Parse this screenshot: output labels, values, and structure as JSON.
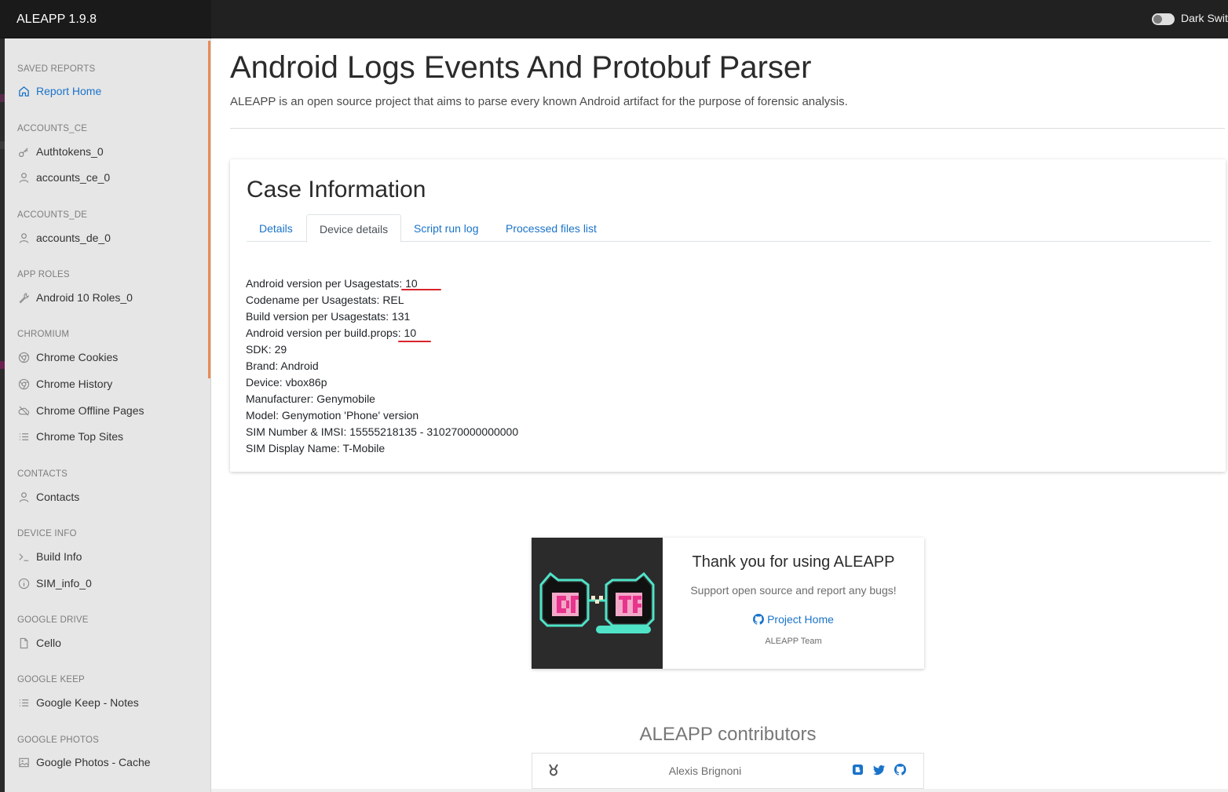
{
  "app": {
    "title": "ALEAPP 1.9.8",
    "dark_switch_label": "Dark Switch"
  },
  "sidebar": {
    "sections": [
      {
        "header": "SAVED REPORTS",
        "items": [
          {
            "label": "Report Home",
            "icon": "home-icon",
            "active": true
          }
        ]
      },
      {
        "header": "ACCOUNTS_CE",
        "items": [
          {
            "label": "Authtokens_0",
            "icon": "key-icon"
          },
          {
            "label": "accounts_ce_0",
            "icon": "user-icon"
          }
        ]
      },
      {
        "header": "ACCOUNTS_DE",
        "items": [
          {
            "label": "accounts_de_0",
            "icon": "user-icon"
          }
        ]
      },
      {
        "header": "APP ROLES",
        "items": [
          {
            "label": "Android 10 Roles_0",
            "icon": "wrench-icon"
          }
        ]
      },
      {
        "header": "CHROMIUM",
        "items": [
          {
            "label": "Chrome Cookies",
            "icon": "chrome-icon"
          },
          {
            "label": "Chrome History",
            "icon": "chrome-icon"
          },
          {
            "label": "Chrome Offline Pages",
            "icon": "cloud-off-icon"
          },
          {
            "label": "Chrome Top Sites",
            "icon": "list-icon"
          }
        ]
      },
      {
        "header": "CONTACTS",
        "items": [
          {
            "label": "Contacts",
            "icon": "user-icon"
          }
        ]
      },
      {
        "header": "DEVICE INFO",
        "items": [
          {
            "label": "Build Info",
            "icon": "terminal-icon"
          },
          {
            "label": "SIM_info_0",
            "icon": "info-icon"
          }
        ]
      },
      {
        "header": "GOOGLE DRIVE",
        "items": [
          {
            "label": "Cello",
            "icon": "file-icon"
          }
        ]
      },
      {
        "header": "GOOGLE KEEP",
        "items": [
          {
            "label": "Google Keep - Notes",
            "icon": "list-icon"
          }
        ]
      },
      {
        "header": "GOOGLE PHOTOS",
        "items": [
          {
            "label": "Google Photos - Cache",
            "icon": "image-icon"
          }
        ]
      }
    ]
  },
  "main": {
    "title": "Android Logs Events And Protobuf Parser",
    "subtitle": "ALEAPP is an open source project that aims to parse every known Android artifact for the purpose of forensic analysis."
  },
  "case": {
    "title": "Case Information",
    "tabs": [
      {
        "label": "Details",
        "active": false
      },
      {
        "label": "Device details",
        "active": true
      },
      {
        "label": "Script run log",
        "active": false
      },
      {
        "label": "Processed files list",
        "active": false
      }
    ],
    "device_details": [
      "Android version per Usagestats: 10",
      "Codename per Usagestats: REL",
      "Build version per Usagestats: 131",
      "Android version per build.props: 10",
      "SDK: 29",
      "Brand: Android",
      "Device: vbox86p",
      "Manufacturer: Genymobile",
      "Model: Genymotion 'Phone' version",
      "SIM Number & IMSI: 15555218135 - 310270000000000",
      "SIM Display Name: T-Mobile"
    ],
    "annotation_color": "#d8242a"
  },
  "thanks": {
    "title": "Thank you for using ALEAPP",
    "subtitle": "Support open source and report any bugs!",
    "link": "Project Home",
    "team": "ALEAPP Team"
  },
  "contributors": {
    "title": "ALEAPP contributors",
    "rows": [
      {
        "name": "Alexis Brignoni"
      }
    ]
  },
  "colors": {
    "accent": "#1a73c9",
    "topbar": "#212121",
    "sidebar": "#e6e6e6"
  }
}
